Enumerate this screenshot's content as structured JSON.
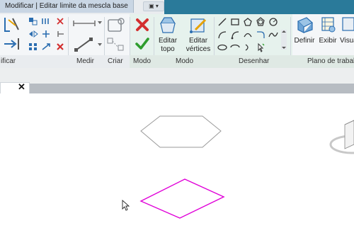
{
  "window": {
    "title": "Modificar | Editar limite da mescla base"
  },
  "ribbon": {
    "panels": {
      "modify": "ificar",
      "measure": "Medir",
      "create": "Criar",
      "mode1": "Modo",
      "mode2": "Modo",
      "draw": "Desenhar",
      "work_plane": "Plano de trabal"
    },
    "buttons": {
      "edit_top": [
        "Editar",
        "topo"
      ],
      "edit_vertices": [
        "Editar",
        "vértices"
      ],
      "define": "Definir",
      "show": "Exibir",
      "viewer": "Visua"
    }
  },
  "document": {
    "close_glyph": "✕"
  },
  "colors": {
    "accent": "#2a7a9a",
    "sketch": "#e000d8",
    "finish": "#2e9d2e",
    "cancel": "#d32f2f"
  }
}
